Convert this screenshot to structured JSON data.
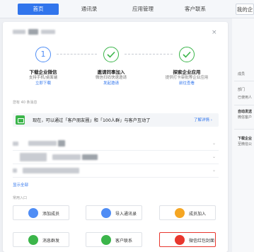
{
  "nav": {
    "tabs": [
      "首页",
      "通讯录",
      "应用管理",
      "客户联系",
      "我的企"
    ],
    "active_tab": "首页"
  },
  "side": {
    "label_member": "成员",
    "label_dept": "部门",
    "label_used": "已使用人",
    "label_auto1": "自动发送",
    "label_auto2": "微信客户",
    "label_download": "下载企业",
    "label_company": "至微信公"
  },
  "close_label": "×",
  "steps": [
    {
      "number": "1",
      "title": "下载企业微信",
      "subtitle": "支持手机/桌面端",
      "link": "立即下载",
      "status": "current"
    },
    {
      "number": "",
      "title": "邀请同事加入",
      "subtitle": "微信扫码快速邀请",
      "link": "发起邀请",
      "status": "done"
    },
    {
      "number": "",
      "title": "探索企业应用",
      "subtitle": "提供打卡审批等企业应用",
      "link": "前往查看",
      "status": "done"
    }
  ],
  "messages_label": "您有 40 条消息",
  "notice": {
    "text": "现在，可以通过「客户朋友圈」和「100人群」与客户互动了",
    "link": "了解详情 ›"
  },
  "show_all": "显示全部",
  "common_label": "常用入口",
  "entries": [
    {
      "label": "添加成员",
      "color": "#4f8df5"
    },
    {
      "label": "导入通讯录",
      "color": "#4f8df5"
    },
    {
      "label": "成员加入",
      "color": "#f5a623"
    },
    {
      "label": "消息群发",
      "color": "#3bb54a"
    },
    {
      "label": "客户联系",
      "color": "#3bb54a"
    },
    {
      "label": "微信红包封面",
      "color": "#e8372e"
    }
  ]
}
